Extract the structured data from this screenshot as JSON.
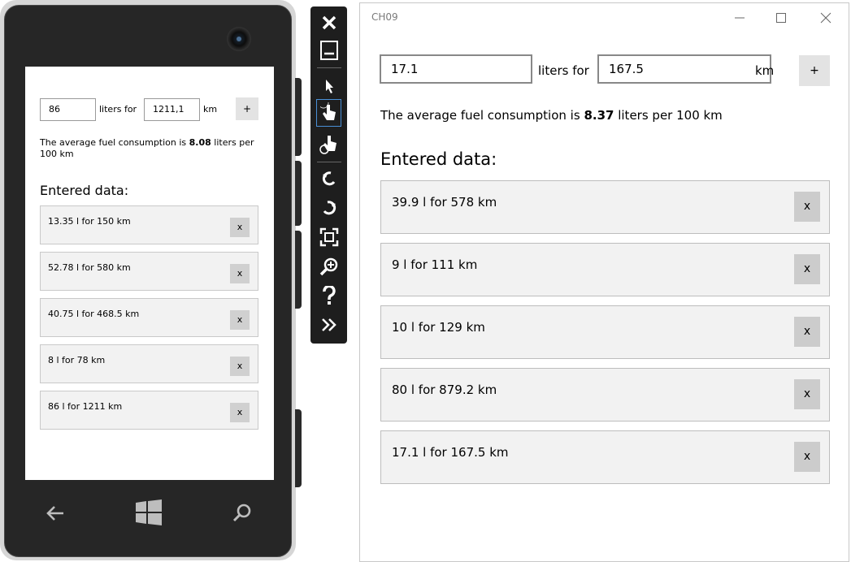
{
  "phone": {
    "fuel_value": "86",
    "liters_for_label": "liters for",
    "distance_value": "1211,1",
    "km_label": "km",
    "add_label": "+",
    "average_prefix": "The average fuel consumption is ",
    "average_value": "8.08",
    "average_suffix": " liters per 100 km",
    "heading": "Entered data:",
    "entries": [
      {
        "label": "13.35 l for 150 km",
        "remove": "x"
      },
      {
        "label": "52.78 l for 580 km",
        "remove": "x"
      },
      {
        "label": "40.75 l for 468.5 km",
        "remove": "x"
      },
      {
        "label": "8 l for 78 km",
        "remove": "x"
      },
      {
        "label": "86 l for 1211 km",
        "remove": "x"
      }
    ],
    "nav": [
      "back-icon",
      "windows-icon",
      "search-icon"
    ]
  },
  "toolbar": {
    "buttons": [
      "close-icon",
      "minimize-icon",
      "pointer-icon",
      "single-touch-icon",
      "multi-touch-icon",
      "rotate-left-icon",
      "rotate-right-icon",
      "fit-to-screen-icon",
      "zoom-icon",
      "help-icon",
      "more-icon"
    ]
  },
  "window": {
    "title": "CH09",
    "fuel_value": "17.1",
    "liters_for_label": "liters for",
    "distance_value": "167.5",
    "km_label": "km",
    "add_label": "+",
    "average_prefix": "The average fuel consumption is ",
    "average_value": "8.37",
    "average_suffix": " liters per 100 km",
    "heading": "Entered data:",
    "entries": [
      {
        "label": "39.9 l for 578 km",
        "remove": "x"
      },
      {
        "label": "9 l for 111 km",
        "remove": "x"
      },
      {
        "label": "10 l for 129 km",
        "remove": "x"
      },
      {
        "label": "80 l for 879.2 km",
        "remove": "x"
      },
      {
        "label": "17.1 l for 167.5 km",
        "remove": "x"
      }
    ]
  }
}
